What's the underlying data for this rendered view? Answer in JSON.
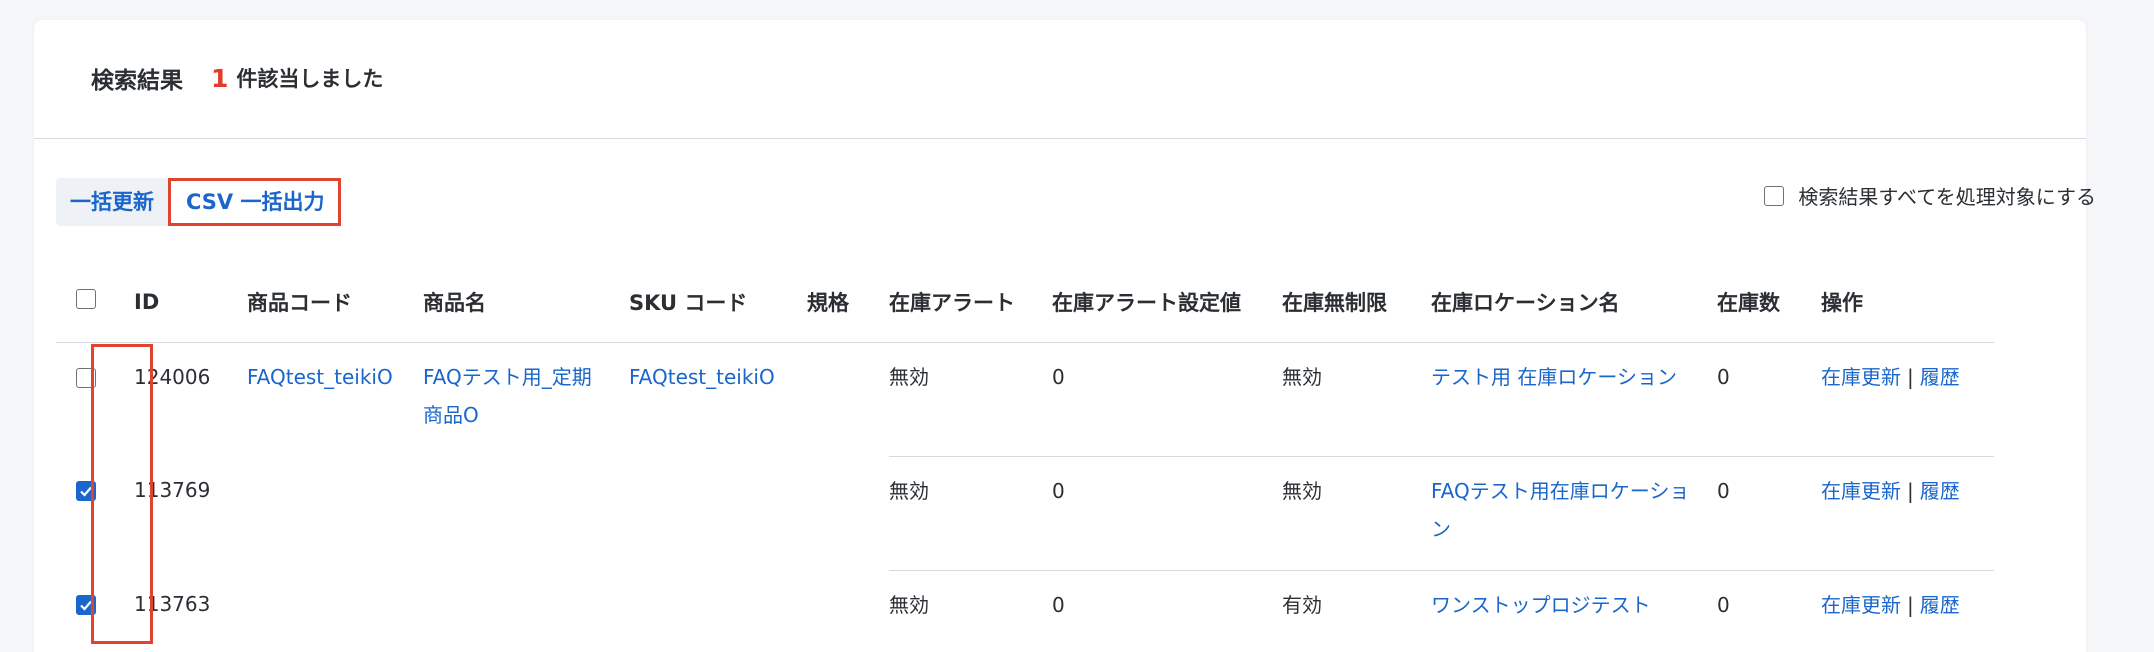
{
  "header": {
    "title": "検索結果",
    "count": "1",
    "suffix": "件該当しました"
  },
  "toolbar": {
    "bulk_update_label": "一括更新",
    "csv_export_label": "CSV 一括出力",
    "select_all_label": "検索結果すべてを処理対象にする"
  },
  "table": {
    "headers": {
      "id": "ID",
      "product_code": "商品コード",
      "product_name": "商品名",
      "sku_code": "SKU コード",
      "spec": "規格",
      "stock_alert": "在庫アラート",
      "stock_alert_value": "在庫アラート設定値",
      "unlimited": "在庫無制限",
      "location": "在庫ロケーション名",
      "quantity": "在庫数",
      "operations": "操作"
    },
    "rows": [
      {
        "checked": false,
        "id": "124006",
        "product_code": "FAQtest_teikiO",
        "product_name": "FAQテスト用_定期商品O",
        "sku_code": "FAQtest_teikiO",
        "spec": "",
        "stock_alert": "無効",
        "stock_alert_value": "0",
        "unlimited": "無効",
        "location": "テスト用 在庫ロケーション",
        "quantity": "0",
        "op_update": "在庫更新",
        "op_separator": "|",
        "op_history": "履歴"
      },
      {
        "checked": true,
        "id": "113769",
        "product_code": "",
        "product_name": "",
        "sku_code": "",
        "spec": "",
        "stock_alert": "無効",
        "stock_alert_value": "0",
        "unlimited": "無効",
        "location": "FAQテスト用在庫ロケーション",
        "quantity": "0",
        "op_update": "在庫更新",
        "op_separator": "|",
        "op_history": "履歴"
      },
      {
        "checked": true,
        "id": "113763",
        "product_code": "",
        "product_name": "",
        "sku_code": "",
        "spec": "",
        "stock_alert": "無効",
        "stock_alert_value": "0",
        "unlimited": "有効",
        "location": "ワンストップロジテスト",
        "quantity": "0",
        "op_update": "在庫更新",
        "op_separator": "|",
        "op_history": "履歴"
      }
    ]
  },
  "colors": {
    "accent": "#1a66cc",
    "highlight_border": "#e0442f",
    "count_red": "#e03c2c"
  },
  "icons": {
    "checkbox": "checkbox-icon",
    "checkmark": "checkmark-icon"
  }
}
